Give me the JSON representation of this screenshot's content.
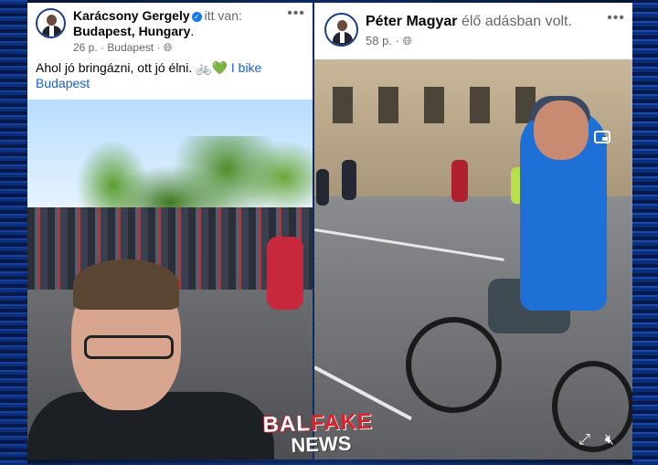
{
  "left_post": {
    "author_name": "Karácsony Gergely",
    "author_suffix": "itt van:",
    "location_line": "Budapest, Hungary",
    "time": "26 p.",
    "place": "Budapest",
    "privacy_icon": "globe-icon",
    "more_label": "•••",
    "text_main": "Ahol jó bringázni, ott jó élni.",
    "text_emoji": "🚲💚",
    "text_link": "I bike Budapest"
  },
  "right_post": {
    "author_name": "Péter Magyar",
    "author_suffix": "élő adásban volt.",
    "time": "58 p.",
    "privacy_icon": "globe-icon",
    "more_label": "•••"
  },
  "watermark": {
    "part1": "BAL",
    "part2": "FAKE",
    "part3": "NEWS"
  },
  "colors": {
    "link": "#1a61d1",
    "verified": "#1877f2",
    "watermark_red": "#e11f2c",
    "background_blue": "#0d2a66"
  }
}
